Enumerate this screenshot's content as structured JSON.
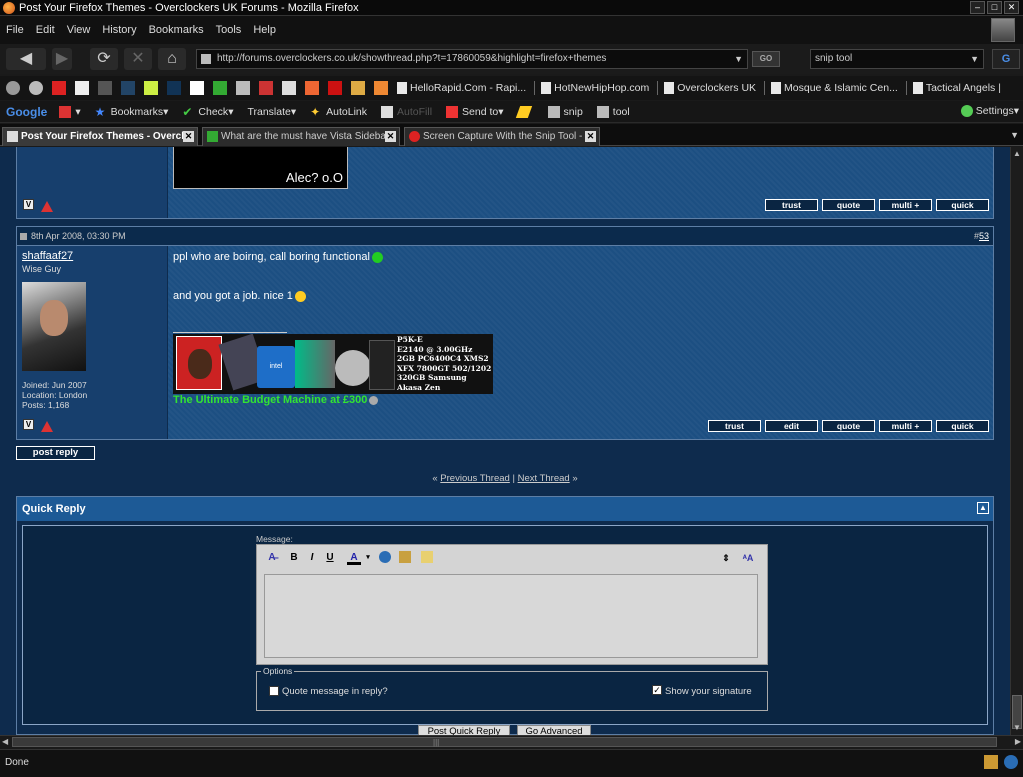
{
  "window": {
    "title": "Post Your Firefox Themes - Overclockers UK Forums - Mozilla Firefox"
  },
  "menu": [
    "File",
    "Edit",
    "View",
    "History",
    "Bookmarks",
    "Tools",
    "Help"
  ],
  "nav": {
    "url": "http://forums.overclockers.co.uk/showthread.php?t=17860059&highlight=firefox+themes",
    "go_label": "GO",
    "search_value": "snip tool",
    "search_engine": "G"
  },
  "bookmarks": [
    "HelloRapid.Com - Rapi...",
    "HotNewHipHop.com",
    "Overclockers UK",
    "Mosque & Islamic Cen...",
    "Tactical Angels |"
  ],
  "google_toolbar": {
    "logo": "Google",
    "items": [
      "Bookmarks",
      "Check",
      "Translate",
      "AutoLink",
      "AutoFill",
      "Send to",
      "snip",
      "tool"
    ],
    "settings": "Settings"
  },
  "tabs": [
    {
      "label": "Post Your Firefox Themes - Overcl...",
      "active": true
    },
    {
      "label": "What are the must have Vista Sideba...",
      "active": false
    },
    {
      "label": "Screen Capture With the Snip Tool - ...",
      "active": false
    }
  ],
  "post_prev": {
    "image_caption": "Alec? o.O",
    "buttons": [
      "trust",
      "quote",
      "multi +",
      "quick"
    ]
  },
  "post": {
    "date": "8th Apr 2008, 03:30 PM",
    "number_prefix": "#",
    "number": "53",
    "username": "shaffaaf27",
    "user_title": "Wise Guy",
    "joined": "Joined: Jun 2007",
    "location": "Location: London",
    "posts": "Posts: 1,168",
    "line1": "ppl who are boirng, call boring functional",
    "line2": "and you got a job. nice 1",
    "sig_specs": [
      "P5K-E",
      "E2140 @ 3.00GHz",
      "2GB PC6400C4 XMS2",
      "XFX 7800GT 502/1202",
      "320GB Samsung",
      "Akasa Zen"
    ],
    "sig_text": "The Ultimate Budget Machine at £300",
    "buttons": [
      "trust",
      "edit",
      "quote",
      "multi +",
      "quick"
    ]
  },
  "post_reply_label": "post reply",
  "thread_nav": {
    "prev": "Previous Thread",
    "next": "Next Thread",
    "left_quote": "«",
    "right_quote": "»",
    "sep": "|"
  },
  "quick_reply": {
    "title": "Quick Reply",
    "message_label": "Message:",
    "options_legend": "Options",
    "quote_label": "Quote message in reply?",
    "signature_label": "Show your signature",
    "submit_label": "Post Quick Reply",
    "advanced_label": "Go Advanced"
  },
  "status": {
    "text": "Done"
  }
}
